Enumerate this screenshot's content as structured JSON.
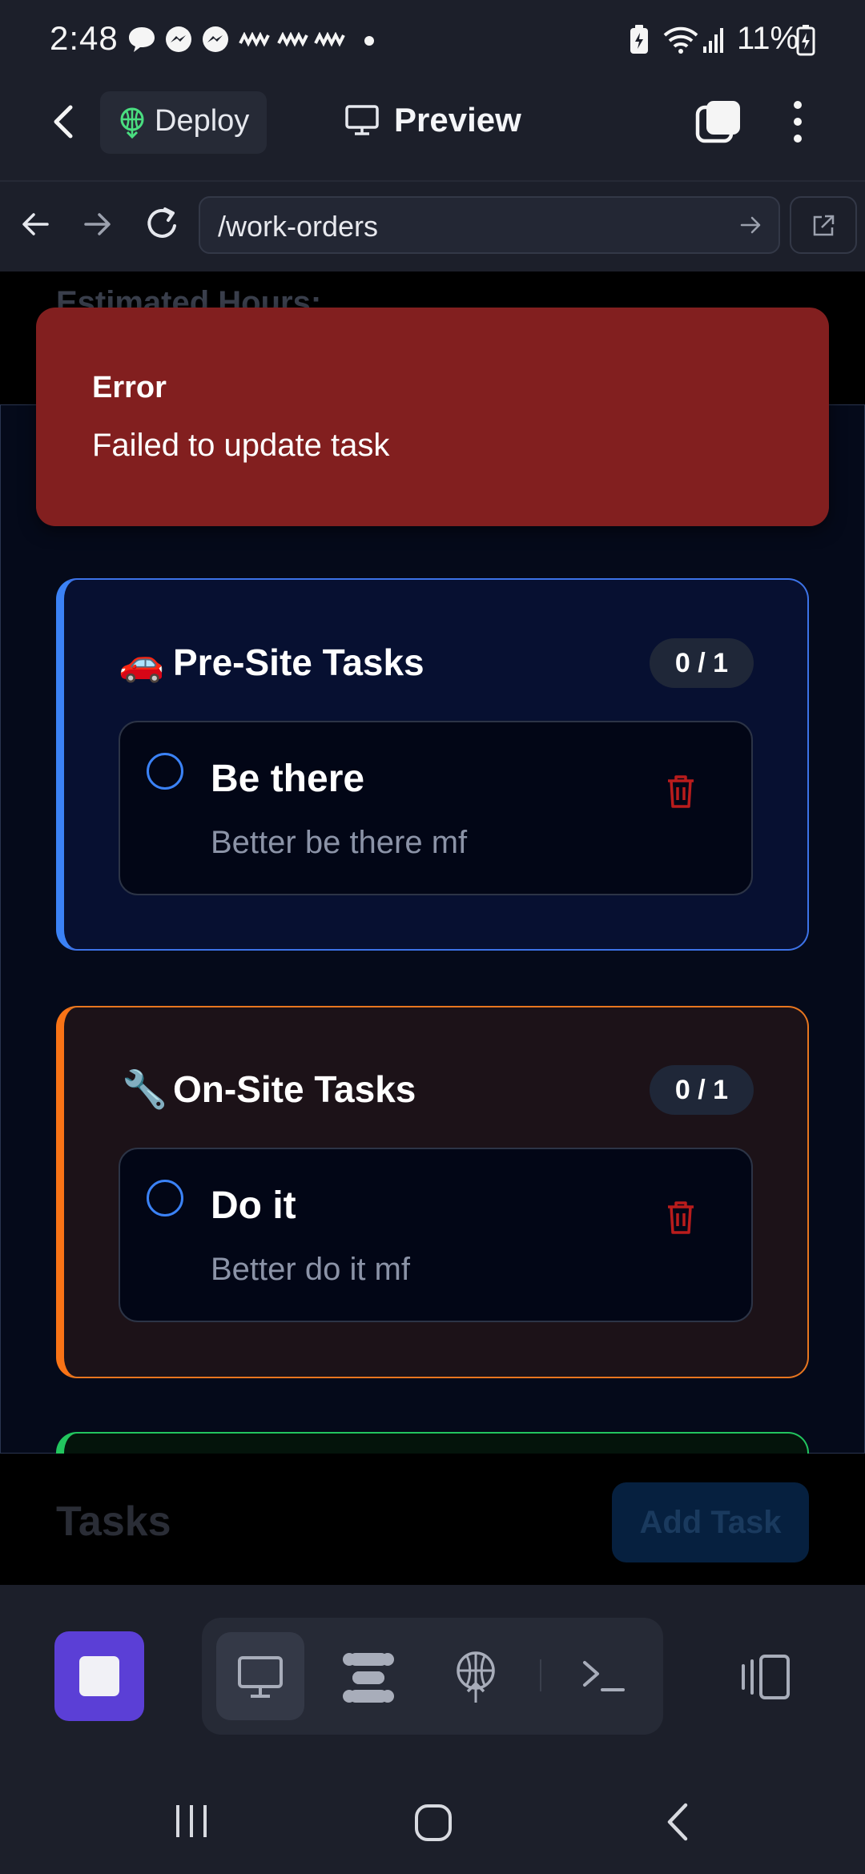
{
  "status_bar": {
    "time": "2:48",
    "notification_icons": [
      "message-icon",
      "messenger-icon",
      "messenger-icon",
      "voicemail-icon",
      "voicemail-icon",
      "voicemail-icon",
      "dot-icon"
    ],
    "battery": "11%"
  },
  "app_bar": {
    "deploy_label": "Deploy",
    "preview_label": "Preview"
  },
  "url_bar": {
    "url": "/work-orders"
  },
  "page": {
    "partial_heading": "Estimated Hours:"
  },
  "toast": {
    "title": "Error",
    "message": "Failed to update task"
  },
  "sections": [
    {
      "icon": "🚗",
      "title": "Pre-Site Tasks",
      "count": "0 / 1",
      "accent": "#3b82f6",
      "tasks": [
        {
          "title": "Be there",
          "description": "Better be there mf"
        }
      ]
    },
    {
      "icon": "🔧",
      "title": "On-Site Tasks",
      "count": "0 / 1",
      "accent": "#f97316",
      "tasks": [
        {
          "title": "Do it",
          "description": "Better do it mf"
        }
      ]
    }
  ],
  "third_section_accent": "#22c55e",
  "footer": {
    "heading": "Tasks",
    "add_task_label": "Add Task"
  },
  "colors": {
    "error_bg": "#821f1f",
    "stop_button": "#5b3fd6",
    "delete_icon": "#dc2626"
  }
}
